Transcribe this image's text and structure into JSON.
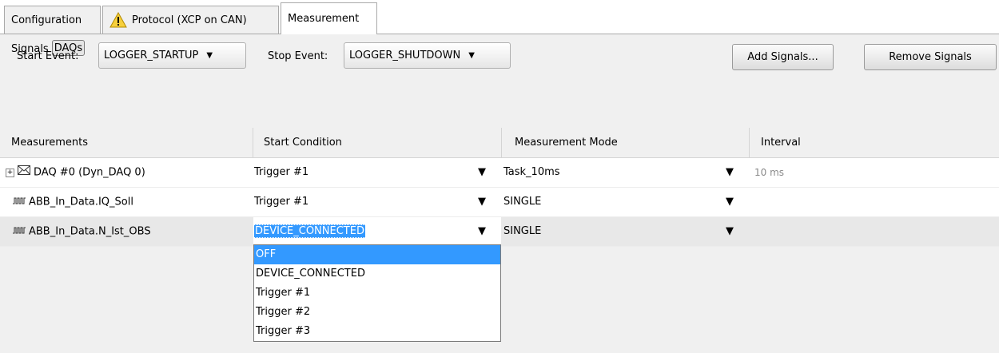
{
  "tabs": [
    {
      "label": "Configuration",
      "icon": "none"
    },
    {
      "label": "Protocol (XCP on CAN)",
      "icon": "warning-icon"
    },
    {
      "label": "Measurement",
      "icon": "none"
    }
  ],
  "subtabs": [
    {
      "label": "Signals"
    },
    {
      "label": "DAQs"
    }
  ],
  "events": {
    "start_label": "Start Event:",
    "start_value": "LOGGER_STARTUP",
    "stop_label": "Stop Event:",
    "stop_value": "LOGGER_SHUTDOWN"
  },
  "buttons": {
    "add": "Add Signals...",
    "remove": "Remove Signals"
  },
  "table": {
    "headers": [
      "Measurements",
      "Start Condition",
      "Measurement Mode",
      "Interval"
    ],
    "rows": [
      {
        "name": "DAQ #0 (Dyn_DAQ 0)",
        "start": "Trigger #1",
        "mode": "Task_10ms",
        "interval": "10 ms"
      },
      {
        "name": "ABB_In_Data.IQ_Soll",
        "start": "Trigger #1",
        "mode": "SINGLE",
        "interval": ""
      },
      {
        "name": "ABB_In_Data.N_Ist_OBS",
        "start": "DEVICE_CONNECTED",
        "mode": "SINGLE",
        "interval": ""
      }
    ]
  },
  "dropdown_options": [
    "OFF",
    "DEVICE_CONNECTED",
    "Trigger #1",
    "Trigger #2",
    "Trigger #3"
  ],
  "colors": {
    "selection": "#3399ff",
    "panel": "#f0f0f0"
  }
}
